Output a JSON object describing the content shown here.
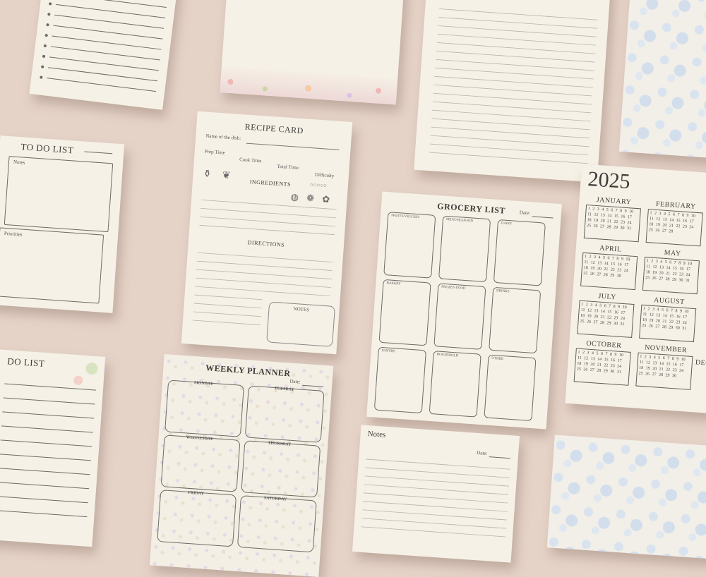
{
  "todo": {
    "title": "TO DO LIST",
    "notes": "Notes",
    "priorities": "Priorities"
  },
  "todo2": {
    "title": "DO LIST"
  },
  "recipe": {
    "title": "RECIPE CARD",
    "dish": "Name of the dish:",
    "prep": "Prep Time",
    "cook": "Cook Time",
    "total": "Total Time",
    "difficulty": "Difficulty",
    "ingredients": "INGREDIENTS",
    "directions": "DIRECTIONS",
    "notes": "NOTES"
  },
  "grocery": {
    "title": "GROCERY LIST",
    "date": "Date:",
    "sections": [
      "FRUITS/VEGGIES",
      "MEAT/SEAFOOD",
      "DAIRY",
      "BAKERY",
      "FROZEN FOOD",
      "DRINKS",
      "PANTRY",
      "HOUSEHOLD",
      "OTHER"
    ]
  },
  "weekly": {
    "title": "WEEKLY PLANNER",
    "date": "Date:",
    "days": [
      "MONDAY",
      "TUESDAY",
      "WEDNESDAY",
      "THURSDAY",
      "FRIDAY",
      "SATURDAY"
    ]
  },
  "notes": {
    "title": "Notes",
    "date": "Date:"
  },
  "calendar": {
    "year": "2025",
    "months": [
      "JANUARY",
      "FEBRUARY",
      "APRIL",
      "MAY",
      "JULY",
      "AUGUST",
      "OCTOBER",
      "NOVEMBER",
      "DEC"
    ]
  },
  "colors": {
    "background": "#e6d3c8",
    "paper": "#f6f1e6",
    "ink": "#4b4b46"
  }
}
